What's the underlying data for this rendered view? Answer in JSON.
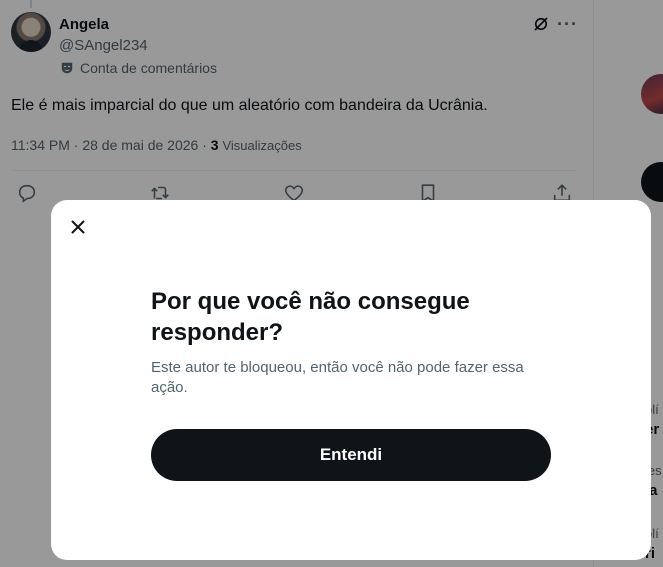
{
  "tweet": {
    "author_name": "Angela",
    "author_handle": "@SAngel234",
    "community_label": "Conta de comentários",
    "text": "Ele é mais imparcial do que um aleatório com bandeira da Ucrânia.",
    "time": "11:34 PM",
    "date": "28 de mai de 2026",
    "views_count": "3",
    "views_label": "Visualizações",
    "more_glyph": "···",
    "icons": [
      "grok-icon",
      "more-icon",
      "mask-icon",
      "reply-icon",
      "repost-icon",
      "like-icon",
      "bookmark-icon",
      "share-icon"
    ]
  },
  "right_column": {
    "fragments": [
      "olí",
      "er",
      "les",
      "la",
      "olí",
      "ri"
    ]
  },
  "modal": {
    "close_label": "×",
    "title": "Por que você não consegue responder?",
    "body": "Este autor te bloqueou, então você não pode fazer essa ação.",
    "button_label": "Entendi"
  },
  "colors": {
    "text_primary": "#0f1419",
    "text_secondary": "#536471",
    "button_bg": "#0f1419",
    "overlay": "rgba(0,0,0,0.4)"
  }
}
